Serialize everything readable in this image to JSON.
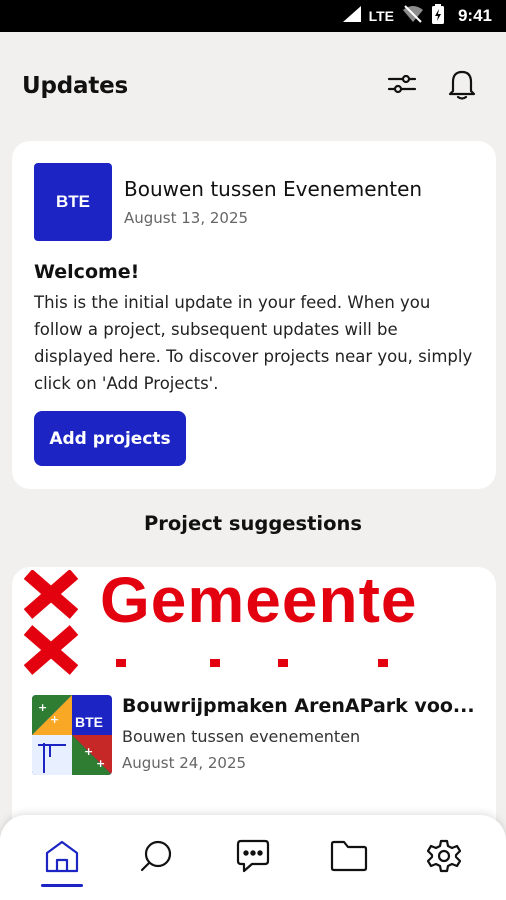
{
  "status_bar": {
    "network": "LTE",
    "time": "9:41"
  },
  "header": {
    "title": "Updates",
    "filter_icon": "sliders-icon",
    "notifications_icon": "bell-icon"
  },
  "welcome_card": {
    "source_logo_text": "BTE",
    "source_name": "Bouwen tussen Evenementen",
    "date": "August 13, 2025",
    "heading": "Welcome!",
    "body": "This is the initial update in your feed. When you follow a project, subsequent updates will be displayed here. To discover projects near you, simply click on 'Add Projects'.",
    "button_label": "Add projects"
  },
  "suggestions": {
    "title": "Project suggestions",
    "items": [
      {
        "banner_word": "Gemeente",
        "logo_text": "BTE",
        "title": "Bouwrijpmaken ArenAPark voo...",
        "subtitle": "Bouwen tussen evenementen",
        "date": "August 24, 2025"
      }
    ]
  },
  "bottom_nav": {
    "items": [
      {
        "icon": "home-icon",
        "active": true
      },
      {
        "icon": "search-icon",
        "active": false
      },
      {
        "icon": "chat-icon",
        "active": false
      },
      {
        "icon": "folder-icon",
        "active": false
      },
      {
        "icon": "settings-icon",
        "active": false
      }
    ]
  },
  "colors": {
    "primary": "#1c24c4",
    "gemeente_red": "#e3000f",
    "background": "#f1f0ef"
  }
}
